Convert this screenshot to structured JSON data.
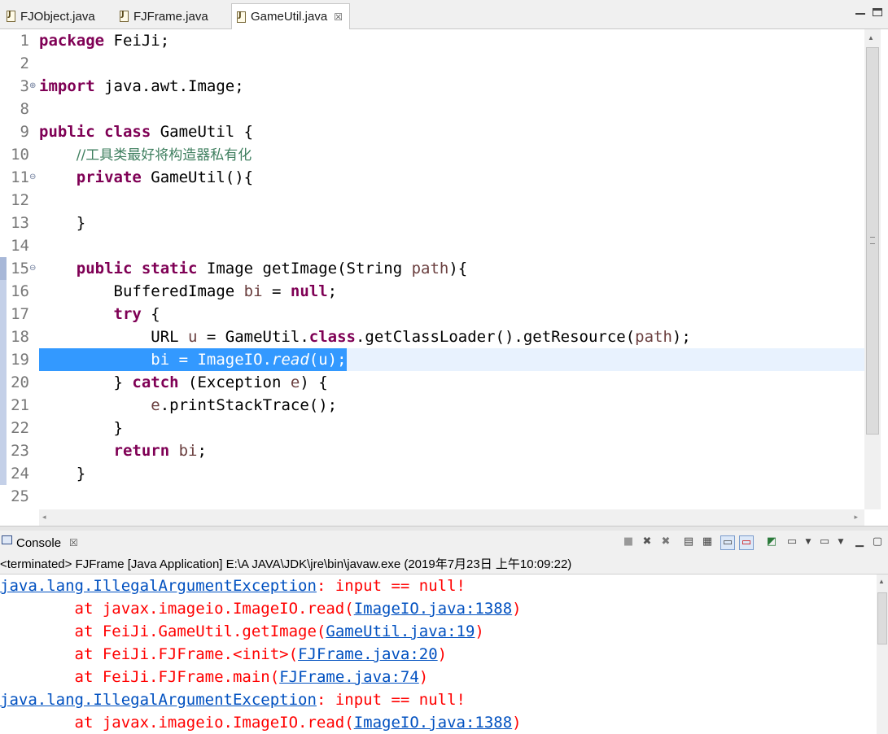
{
  "tabs": [
    {
      "label": "FJObject.java",
      "active": false
    },
    {
      "label": "FJFrame.java",
      "active": false
    },
    {
      "label": "GameUtil.java",
      "active": true,
      "close": "☒"
    }
  ],
  "editor": {
    "line_numbers": [
      "1",
      "2",
      "3",
      "8",
      "9",
      "10",
      "11",
      "12",
      "13",
      "14",
      "15",
      "16",
      "17",
      "18",
      "19",
      "20",
      "21",
      "22",
      "23",
      "24",
      "25"
    ],
    "code": {
      "l1_kw": "package",
      "l1_rest": " FeiJi;",
      "l3_kw": "import",
      "l3_rest": " java.awt.Image;",
      "l9_kw1": "public",
      "l9_kw2": " class",
      "l9_rest": " GameUtil {",
      "l10_indent": "    ",
      "l10_comment": "//工具类最好将构造器私有化",
      "l11_indent": "    ",
      "l11_kw": "private",
      "l11_rest": " GameUtil(){",
      "l13": "    }",
      "l15_indent": "    ",
      "l15_kw1": "public",
      "l15_kw2": " static",
      "l15_mid": " Image getImage(String ",
      "l15_var": "path",
      "l15_end": "){",
      "l16_a": "        BufferedImage ",
      "l16_var": "bi",
      "l16_b": " = ",
      "l16_kw": "null",
      "l16_end": ";",
      "l17_indent": "        ",
      "l17_kw": "try",
      "l17_end": " {",
      "l18_a": "            URL ",
      "l18_var1": "u",
      "l18_b": " = GameUtil.",
      "l18_kw": "class",
      "l18_c": ".getClassLoader().getResource(",
      "l18_var2": "path",
      "l18_end": ");",
      "l19_indent": "            ",
      "l19_a": "bi = ImageIO.",
      "l19_static": "read",
      "l19_end": "(u);",
      "l20_a": "        } ",
      "l20_kw": "catch",
      "l20_b": " (Exception ",
      "l20_var": "e",
      "l20_end": ") {",
      "l21_a": "            ",
      "l21_var": "e",
      "l21_end": ".printStackTrace();",
      "l22": "        }",
      "l23_indent": "        ",
      "l23_kw": "return",
      "l23_sp": " ",
      "l23_var": "bi",
      "l23_end": ";",
      "l24": "    }"
    }
  },
  "console": {
    "tab_label": "Console",
    "tab_close": "☒",
    "info": "<terminated> FJFrame [Java Application] E:\\A JAVA\\JDK\\jre\\bin\\javaw.exe (2019年7月23日 上午10:09:22)",
    "lines": [
      {
        "pre": "",
        "link": "java.lang.IllegalArgumentException",
        "post": ": input == null!"
      },
      {
        "pre": "\tat javax.imageio.ImageIO.read(",
        "link": "ImageIO.java:1388",
        "post": ")"
      },
      {
        "pre": "\tat FeiJi.GameUtil.getImage(",
        "link": "GameUtil.java:19",
        "post": ")"
      },
      {
        "pre": "\tat FeiJi.FJFrame.<init>(",
        "link": "FJFrame.java:20",
        "post": ")"
      },
      {
        "pre": "\tat FeiJi.FJFrame.main(",
        "link": "FJFrame.java:74",
        "post": ")"
      },
      {
        "pre": "",
        "link": "java.lang.IllegalArgumentException",
        "post": ": input == null!"
      },
      {
        "pre": "\tat javax.imageio.ImageIO.read(",
        "link": "ImageIO.java:1388",
        "post": ")"
      }
    ]
  },
  "colors": {
    "keyword": "#7f0055",
    "variable": "#6a3e3e",
    "comment": "#3f7f5f",
    "selection": "#3399ff",
    "error": "#ff0000",
    "link": "#0050c0"
  }
}
